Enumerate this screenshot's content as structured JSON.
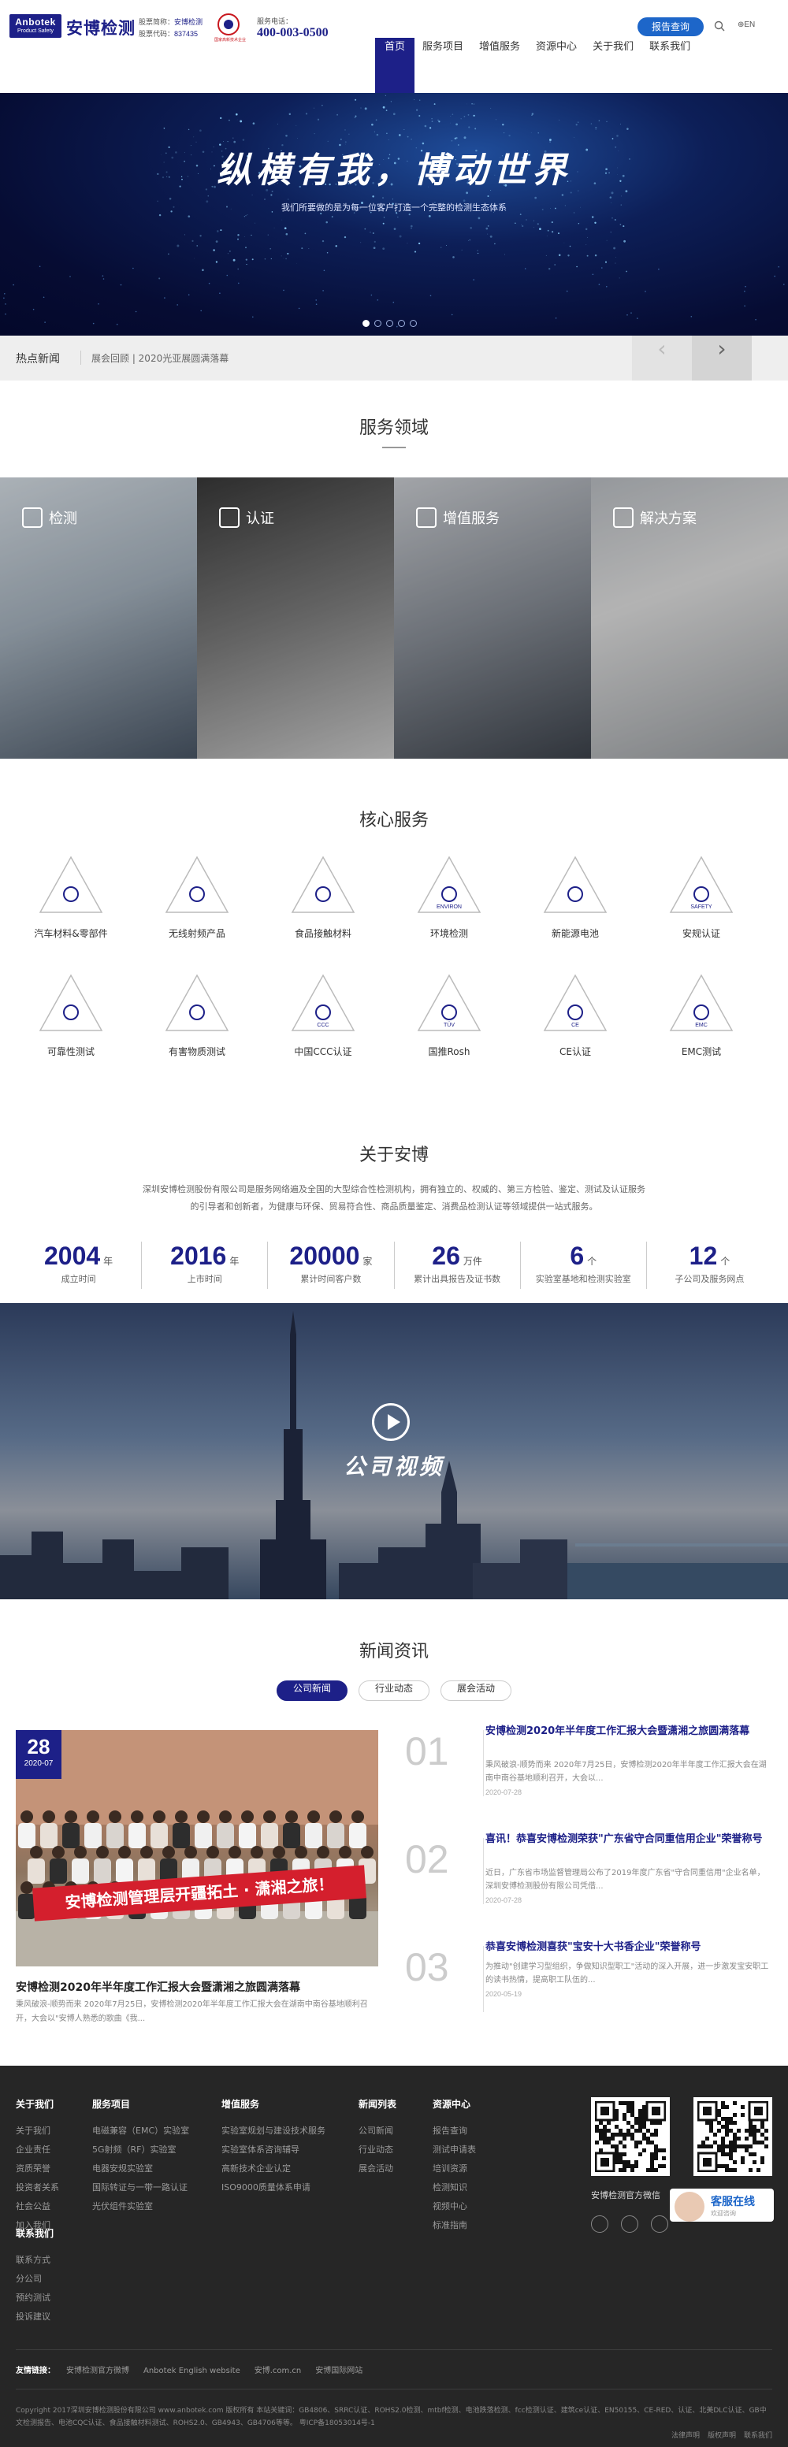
{
  "header": {
    "logo_en": "Anbotek",
    "logo_sub": "Product Safety",
    "logo_cn": "安博检测",
    "stock_name_label": "股票简称：",
    "stock_name": "安博检测",
    "stock_code_label": "股票代码：",
    "stock_code": "837435",
    "emblem_text": "国家高新技术企业",
    "hotline_label": "服务电话：",
    "hotline": "400-003-0500",
    "report_btn": "报告查询",
    "lang": "EN",
    "nav": [
      "首页",
      "服务项目",
      "增值服务",
      "资源中心",
      "关于我们",
      "联系我们"
    ]
  },
  "banner": {
    "title": "纵横有我，博动世界",
    "subtitle": "我们所要做的是为每一位客户打造一个完整的检测生态体系",
    "dots": 5,
    "active_dot": 0
  },
  "hot_news": {
    "label": "热点新闻",
    "item": "展会回顾 | 2020光亚展圆满落幕",
    "prev": "‹",
    "next": "›"
  },
  "service_area": {
    "title": "服务领域",
    "tiles": [
      {
        "label": "检测",
        "icon": "microscope-icon"
      },
      {
        "label": "认证",
        "icon": "certificate-icon"
      },
      {
        "label": "增值服务",
        "icon": "service-icon"
      },
      {
        "label": "解决方案",
        "icon": "solution-icon"
      }
    ]
  },
  "core": {
    "title": "核心服务",
    "items": [
      {
        "label": "汽车材料&零部件",
        "icon": "car-icon",
        "text": ""
      },
      {
        "label": "无线射频产品",
        "icon": "wireless-icon",
        "text": ""
      },
      {
        "label": "食品接触材料",
        "icon": "cutlery-icon",
        "text": ""
      },
      {
        "label": "环境检测",
        "icon": "environ-icon",
        "text": "ENVIRON"
      },
      {
        "label": "新能源电池",
        "icon": "battery-icon",
        "text": ""
      },
      {
        "label": "安规认证",
        "icon": "safety-icon",
        "text": "SAFETY"
      },
      {
        "label": "可靠性测试",
        "icon": "atom-icon",
        "text": ""
      },
      {
        "label": "有害物质测试",
        "icon": "chemical-icon",
        "text": ""
      },
      {
        "label": "中国CCC认证",
        "icon": "ccc-icon",
        "text": "CCC"
      },
      {
        "label": "国推Rosh",
        "icon": "tuv-icon",
        "text": "TÜV"
      },
      {
        "label": "CE认证",
        "icon": "ce-icon",
        "text": "CE"
      },
      {
        "label": "EMC测试",
        "icon": "emc-icon",
        "text": "EMC"
      }
    ]
  },
  "about": {
    "title": "关于安博",
    "desc": "深圳安博检测股份有限公司是服务网络遍及全国的大型综合性检测机构，拥有独立的、权威的、第三方检验、鉴定、测试及认证服务的引导者和创新者，为健康与环保、贸易符合性、商品质量鉴定、消费品检测认证等领域提供一站式服务。",
    "stats": [
      {
        "num": "2004",
        "unit": "年",
        "desc": "成立时间"
      },
      {
        "num": "2016",
        "unit": "年",
        "desc": "上市时间"
      },
      {
        "num": "20000",
        "unit": "家",
        "desc": "累计时间客户数"
      },
      {
        "num": "26",
        "unit": "万件",
        "desc": "累计出具报告及证书数"
      },
      {
        "num": "6",
        "unit": "个",
        "desc": "实验室基地和检测实验室"
      },
      {
        "num": "12",
        "unit": "个",
        "desc": "子公司及服务网点"
      }
    ]
  },
  "video": {
    "title": "公司视频"
  },
  "news": {
    "title": "新闻资讯",
    "tabs": [
      "公司新闻",
      "行业动态",
      "展会活动"
    ],
    "active_tab": 0,
    "featured": {
      "day": "28",
      "ym": "2020-07",
      "banner": "安博检测管理层开疆拓土 · 潇湘之旅！",
      "title": "安博检测2020年半年度工作汇报大会暨潇湘之旅圆满落幕",
      "desc": "秉风破浪-顺势而来 2020年7月25日，安博检测2020年半年度工作汇报大会在湖南中南谷基地顺利召开，大会以\"安博人熟悉的歌曲《我..."
    },
    "list": [
      {
        "num": "01",
        "title": "安博检测2020年半年度工作汇报大会暨潇湘之旅圆满落幕",
        "desc": "秉风破浪-顺势而来 2020年7月25日，安博检测2020年半年度工作汇报大会在湖南中南谷基地顺利召开，大会以...",
        "date": "2020-07-28"
      },
      {
        "num": "02",
        "title": "喜讯！恭喜安博检测荣获\"广东省守合同重信用企业\"荣誉称号",
        "desc": "近日，广东省市场监督管理局公布了2019年度广东省\"守合同重信用\"企业名单，深圳安博检测股份有限公司凭借...",
        "date": "2020-07-28"
      },
      {
        "num": "03",
        "title": "恭喜安博检测喜获\"宝安十大书香企业\"荣誉称号",
        "desc": "为推动\"创建学习型组织，争做知识型职工\"活动的深入开展，进一步激发宝安职工的读书热情，提高职工队伍的...",
        "date": "2020-05-19"
      }
    ]
  },
  "footer": {
    "cols": [
      {
        "title": "关于我们",
        "items": [
          "关于我们",
          "企业责任",
          "资质荣誉",
          "投资者关系",
          "社会公益",
          "加入我们"
        ]
      },
      {
        "title": "服务项目",
        "items": [
          "电磁兼容（EMC）实验室",
          "5G射频（RF）实验室",
          "电器安规实验室",
          "国际转证与一带一路认证",
          "光伏组件实验室"
        ]
      },
      {
        "title": "增值服务",
        "items": [
          "实验室规划与建设技术服务",
          "实验室体系咨询辅导",
          "高新技术企业认定",
          "ISO9000质量体系申请"
        ]
      },
      {
        "title": "新闻列表",
        "items": [
          "公司新闻",
          "行业动态",
          "展会活动"
        ]
      },
      {
        "title": "资源中心",
        "items": [
          "报告查询",
          "测试申请表",
          "培训资源",
          "检测知识",
          "视频中心",
          "标准指南"
        ]
      }
    ],
    "contact": {
      "title": "联系我们",
      "items": [
        "联系方式",
        "分公司",
        "预约测试",
        "投诉建议"
      ]
    },
    "qr_caption": "安博检测官方微信",
    "kefu_title": "客服在线",
    "kefu_sub": "欢迎咨询",
    "friend_label": "友情链接：",
    "friend_links": [
      "安博检测官方微博",
      "Anbotek English website",
      "安博.com.cn",
      "安博国际网站"
    ],
    "copyright": "Copyright 2017深圳安博检测股份有限公司 www.anbotek.com 版权所有 本站关键词：GB4806、SRRC认证、ROHS2.0检测、mtbf检测、电池跌落检测、fcc检测认证、建筑ce认证、EN50155、CE-RED、认证、北美DLC认证、GB中文检测报告、电池CQC认证、食品接触材料测试、ROHS2.0、GB4943、GB4706等等。 粤ICP备18053014号-1",
    "legal": [
      "法律声明",
      "版权声明",
      "联系我们"
    ]
  }
}
